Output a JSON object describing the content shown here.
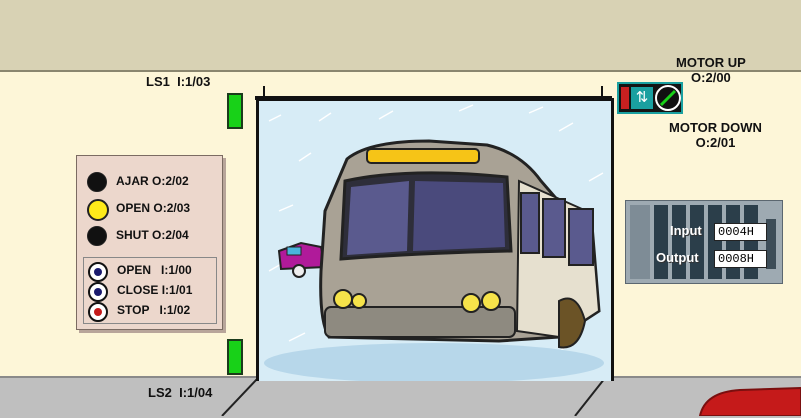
{
  "switches": {
    "ls1": {
      "name": "LS1",
      "addr": "I:1/03"
    },
    "ls2": {
      "name": "LS2",
      "addr": "I:1/04"
    }
  },
  "motor": {
    "up_label": "MOTOR UP",
    "up_addr": "O:2/00",
    "down_label": "MOTOR DOWN",
    "down_addr": "O:2/01",
    "icon": "up-down-arrows-icon"
  },
  "indicators": [
    {
      "label": "AJAR",
      "addr": "O:2/02",
      "color": "#111111"
    },
    {
      "label": "OPEN",
      "addr": "O:2/03",
      "color": "#ffeb1a"
    },
    {
      "label": "SHUT",
      "addr": "O:2/04",
      "color": "#111111"
    }
  ],
  "buttons": [
    {
      "label": "OPEN",
      "addr": "I:1/00",
      "color": "#1a1a6e"
    },
    {
      "label": "CLOSE",
      "addr": "I:1/01",
      "color": "#1a1a6e"
    },
    {
      "label": "STOP",
      "addr": "I:1/02",
      "color": "#c41a1a"
    }
  ],
  "plc": {
    "input_label": "Input",
    "input_value": "0004H",
    "output_label": "Output",
    "output_value": "0008H"
  },
  "colors": {
    "limit_switch": "#18d118",
    "lamp_on": "#ffeb1a",
    "bus_sign": "#f6c417"
  }
}
